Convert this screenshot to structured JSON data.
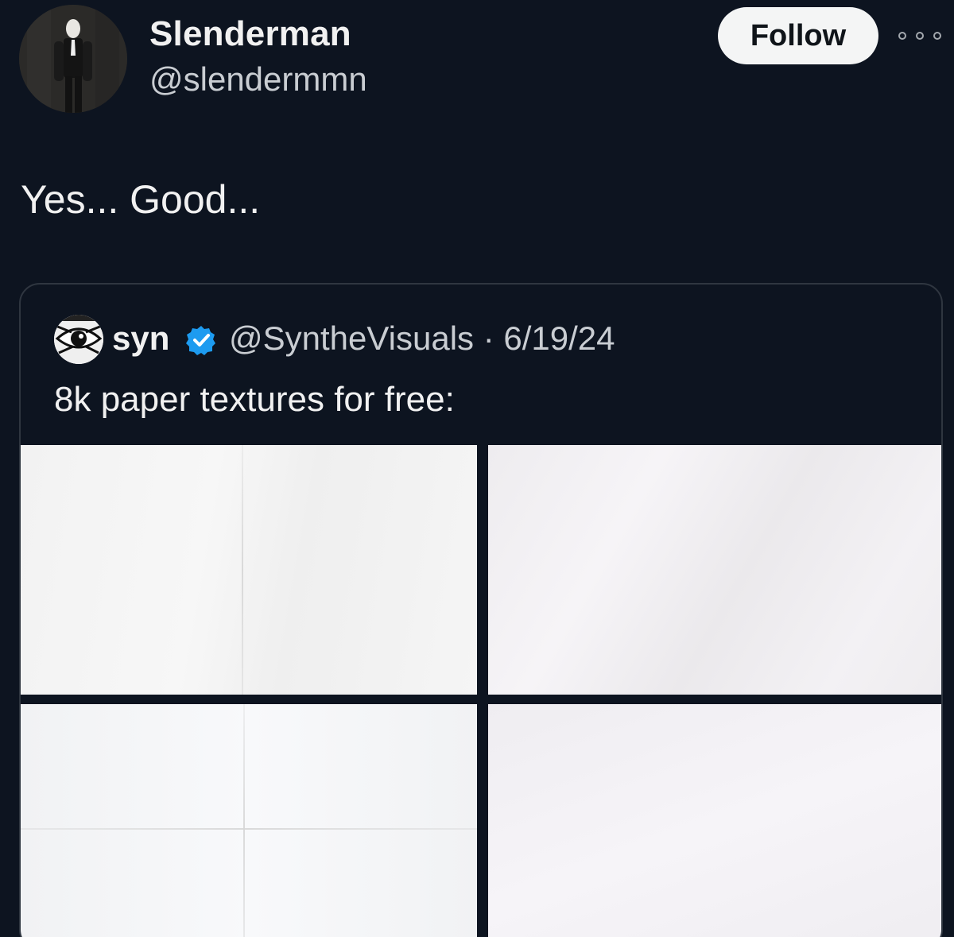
{
  "post": {
    "author": {
      "display_name": "Slenderman",
      "handle": "@slendermmn",
      "avatar_icon": "slenderman-avatar"
    },
    "follow_label": "Follow",
    "more_icon": "more-horizontal-icon",
    "text": "Yes... Good..."
  },
  "quoted_post": {
    "author": {
      "display_name": "syn",
      "verified": true,
      "verified_color": "#1d9bf0",
      "avatar_icon": "eye-avatar"
    },
    "meta": "@SyntheVisuals · 6/19/24",
    "text": "8k paper textures for free:",
    "media": [
      {
        "description": "paper-texture-1"
      },
      {
        "description": "paper-texture-2"
      },
      {
        "description": "paper-texture-3"
      },
      {
        "description": "paper-texture-4"
      }
    ]
  },
  "colors": {
    "background": "#0d1420",
    "text_primary": "#f1f1f1",
    "text_secondary": "#c9cdd2",
    "follow_bg": "#f4f5f5",
    "card_border": "#2f3640"
  }
}
